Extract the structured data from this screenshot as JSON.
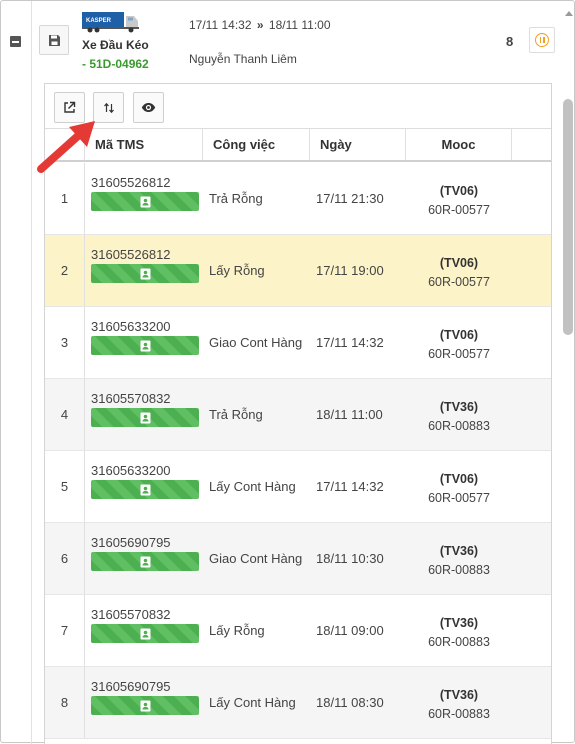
{
  "trip": {
    "vehicle_type": "Xe Đầu Kéo",
    "plate": "- 51D-04962",
    "start_time": "17/11 14:32",
    "end_time": "18/11 11:00",
    "arrow": "»",
    "driver": "Nguyễn Thanh Liêm",
    "count": "8",
    "logo_text": "KASPER"
  },
  "icons": {
    "collapse": "minus-square-icon",
    "save": "floppy-disk-icon",
    "truck": "container-truck-icon",
    "pause": "pause-circle-icon",
    "external": "external-link-icon",
    "sort": "sort-arrows-icon",
    "view": "eye-icon",
    "badge": "contact-card-icon",
    "annotation": "red-arrow-pointer"
  },
  "colors": {
    "plate_green": "#3a9a2f",
    "badge_green": "#4caf50",
    "pause_orange": "#f0a020",
    "selected_row": "#fdf3c8",
    "annotation_red": "#e53935"
  },
  "table": {
    "headers": {
      "tms": "Mã TMS",
      "job": "Công việc",
      "date": "Ngày",
      "mooc": "Mooc"
    },
    "rows": [
      {
        "num": "1",
        "tms": "31605526812",
        "job": "Trả Rỗng",
        "date": "17/11 21:30",
        "mooc_code": "(TV06)",
        "mooc_plate": "60R-00577"
      },
      {
        "num": "2",
        "tms": "31605526812",
        "job": "Lấy Rỗng",
        "date": "17/11 19:00",
        "mooc_code": "(TV06)",
        "mooc_plate": "60R-00577"
      },
      {
        "num": "3",
        "tms": "31605633200",
        "job": "Giao Cont Hàng",
        "date": "17/11 14:32",
        "mooc_code": "(TV06)",
        "mooc_plate": "60R-00577"
      },
      {
        "num": "4",
        "tms": "31605570832",
        "job": "Trả Rỗng",
        "date": "18/11 11:00",
        "mooc_code": "(TV36)",
        "mooc_plate": "60R-00883"
      },
      {
        "num": "5",
        "tms": "31605633200",
        "job": "Lấy Cont Hàng",
        "date": "17/11 14:32",
        "mooc_code": "(TV06)",
        "mooc_plate": "60R-00577"
      },
      {
        "num": "6",
        "tms": "31605690795",
        "job": "Giao Cont Hàng",
        "date": "18/11 10:30",
        "mooc_code": "(TV36)",
        "mooc_plate": "60R-00883"
      },
      {
        "num": "7",
        "tms": "31605570832",
        "job": "Lấy Rỗng",
        "date": "18/11 09:00",
        "mooc_code": "(TV36)",
        "mooc_plate": "60R-00883"
      },
      {
        "num": "8",
        "tms": "31605690795",
        "job": "Lấy Cont Hàng",
        "date": "18/11 08:30",
        "mooc_code": "(TV36)",
        "mooc_plate": "60R-00883"
      }
    ]
  }
}
